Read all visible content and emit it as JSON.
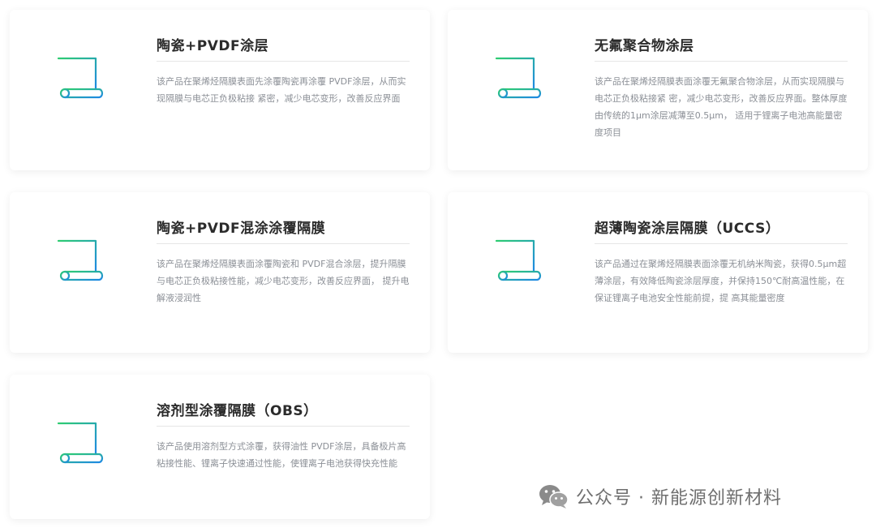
{
  "cards": [
    {
      "icon": "scroll-document-icon",
      "title": "陶瓷+PVDF涂层",
      "description": "该产品在聚烯烃隔膜表面先涂覆陶瓷再涂覆 PVDF涂层，从而实现隔膜与电芯正负极粘接 紧密，减少电芯变形，改善反应界面"
    },
    {
      "icon": "scroll-document-icon",
      "title": "无氟聚合物涂层",
      "description": "该产品在聚烯烃隔膜表面涂覆无氟聚合物涂层，从而实现隔膜与电芯正负极粘接紧 密，减少电芯变形，改善反应界面。整体厚度由传统的1μm涂层减薄至0.5μm， 适用于锂离子电池高能量密度项目"
    },
    {
      "icon": "scroll-document-icon",
      "title": "陶瓷+PVDF混涂涂覆隔膜",
      "description": "该产品在聚烯烃隔膜表面涂覆陶瓷和 PVDF混合涂层，提升隔膜与电芯正负极粘接性能，减少电芯变形，改善反应界面， 提升电解液浸润性"
    },
    {
      "icon": "scroll-document-icon",
      "title": "超薄陶瓷涂层隔膜（UCCS）",
      "description": "该产品通过在聚烯烃隔膜表面涂覆无机纳米陶瓷，获得0.5μm超薄涂层，有效降低陶瓷涂层厚度，并保持150℃耐高温性能，在保证锂离子电池安全性能前提，提 高其能量密度"
    },
    {
      "icon": "scroll-document-icon",
      "title": "溶剂型涂覆隔膜（OBS）",
      "description": "该产品使用溶剂型方式涂覆，获得油性 PVDF涂层，具备极片高粘接性能、锂离子快速通过性能，使锂离子电池获得快充性能"
    }
  ],
  "watermark": {
    "icon": "wechat-icon",
    "text": "公众号 · 新能源创新材料"
  },
  "colors": {
    "icon_gradient_start": "#2ecc71",
    "icon_gradient_end": "#1e88e5",
    "title": "#2b2b2b",
    "description": "#8b8f96"
  }
}
